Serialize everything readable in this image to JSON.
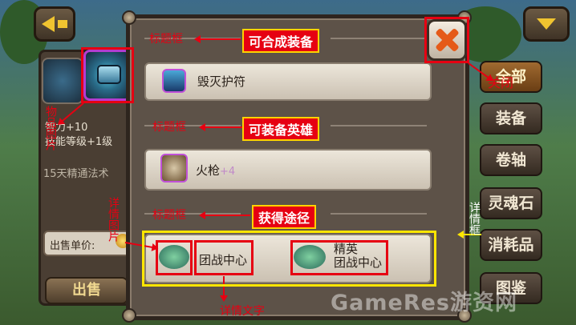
{
  "header": {
    "back_icon": "back-arrow-icon",
    "menu_icon": "dropdown-arrow-icon"
  },
  "left_panel": {
    "lines": [
      "智力+10",
      "技能等级+1级",
      "15天精通法术"
    ],
    "price_label": "出售单价:",
    "sell_button": "出售"
  },
  "tabs": [
    {
      "label": "全部",
      "active": true
    },
    {
      "label": "装备",
      "active": false
    },
    {
      "label": "卷轴",
      "active": false
    },
    {
      "label": "灵魂石",
      "active": false
    },
    {
      "label": "消耗品",
      "active": false
    },
    {
      "label": "图鉴",
      "active": false
    }
  ],
  "dialog": {
    "composable": {
      "item_name": "毁灭护符"
    },
    "equip_hero": {
      "hero_name": "火枪",
      "hero_plus": "+4"
    },
    "sources": [
      {
        "label": "团战中心"
      },
      {
        "label": "精英\n团战中心"
      }
    ]
  },
  "annotations": {
    "title_frame": "标题框",
    "section_titles": [
      "可合成装备",
      "可装备英雄",
      "获得途径"
    ],
    "close_label": "关闭",
    "icon_label": "物品图片",
    "detail_image_label": "详情图片",
    "detail_frame_label": "详情框",
    "detail_text_label": "详情文字"
  },
  "watermark": "GameRes游资网",
  "colors": {
    "annotation_red": "#e60012",
    "annotation_yellow": "#ffe600",
    "close_orange": "#e55a18"
  }
}
